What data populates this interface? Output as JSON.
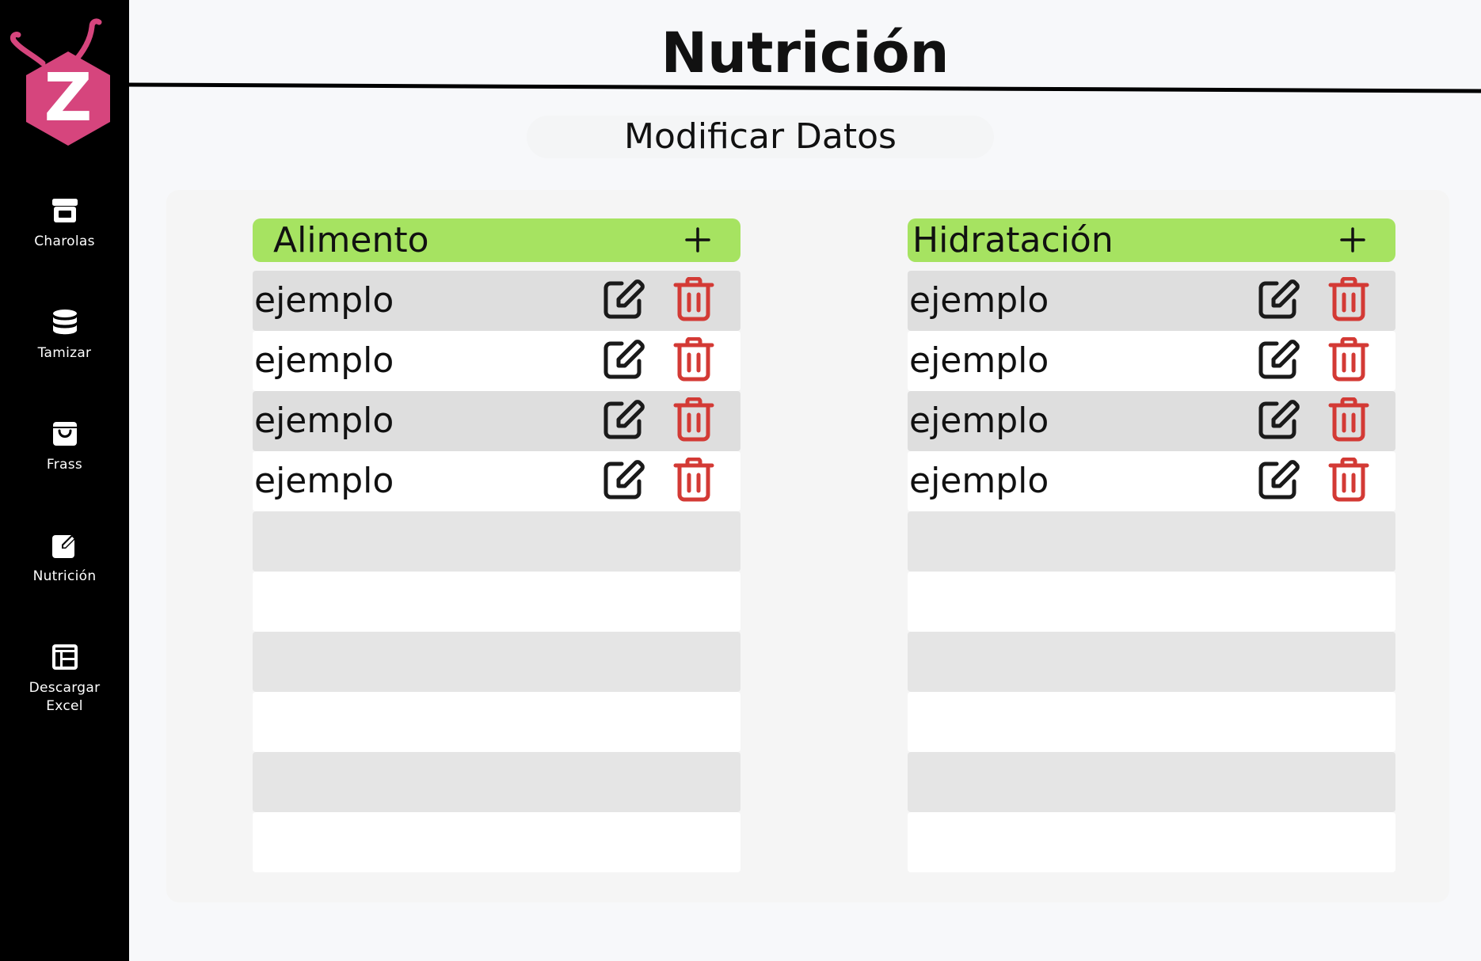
{
  "app": {
    "logo_letter": "Z",
    "logo_color": "#d6457d"
  },
  "sidebar": {
    "items": [
      {
        "label": "Charolas",
        "icon": "archive-box-icon"
      },
      {
        "label": "Tamizar",
        "icon": "database-icon"
      },
      {
        "label": "Frass",
        "icon": "shopping-bag-icon"
      },
      {
        "label": "Nutrición",
        "icon": "edit-note-icon"
      },
      {
        "label": "Descargar Excel",
        "icon": "table-icon"
      }
    ]
  },
  "header": {
    "title": "Nutrición",
    "subtitle": "Modificar Datos"
  },
  "colors": {
    "header_green": "#a6e361",
    "delete_red": "#d33a35",
    "sidebar_bg": "#000000"
  },
  "tables": [
    {
      "title": "Alimento",
      "add_icon": "plus-icon",
      "rows": [
        "ejemplo",
        "ejemplo",
        "ejemplo",
        "ejemplo"
      ],
      "empty_rows": 6
    },
    {
      "title": "Hidratación",
      "add_icon": "plus-icon",
      "rows": [
        "ejemplo",
        "ejemplo",
        "ejemplo",
        "ejemplo"
      ],
      "empty_rows": 6
    }
  ]
}
